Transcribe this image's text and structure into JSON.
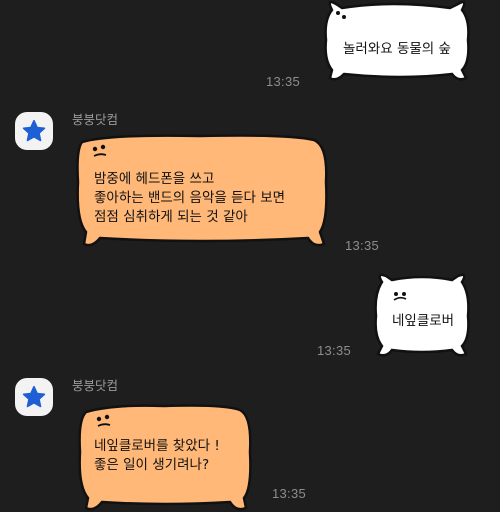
{
  "colors": {
    "background": "#1e1e1e",
    "my_bubble": "#ffffff",
    "their_bubble": "#ffb877",
    "outline": "#111111",
    "avatar_star": "#1f5fd6"
  },
  "messages": [
    {
      "direction": "outgoing",
      "text": "놀러와요 동물의 숲",
      "time": "13:35"
    },
    {
      "direction": "incoming",
      "sender": "붕붕닷컴",
      "avatar_icon": "star-icon",
      "lines": [
        "밤중에 헤드폰을 쓰고",
        "좋아하는 밴드의 음악을 듣다 보면",
        "점점 심취하게 되는 것 같아"
      ],
      "time": "13:35"
    },
    {
      "direction": "outgoing",
      "text": "네잎클로버",
      "time": "13:35"
    },
    {
      "direction": "incoming",
      "sender": "붕붕닷컴",
      "avatar_icon": "star-icon",
      "lines": [
        "네잎클로버를 찾았다 !",
        "좋은 일이 생기려나?"
      ],
      "time": "13:35"
    }
  ]
}
